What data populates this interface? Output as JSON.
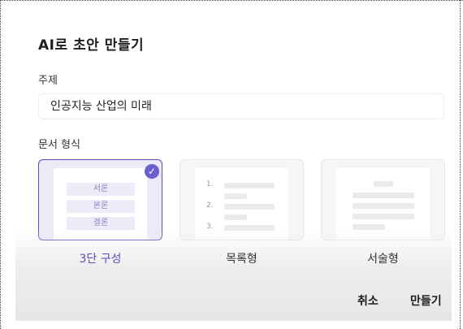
{
  "dialog": {
    "title": "AI로 초안 만들기",
    "topic_label": "주제",
    "topic_value": "인공지능 산업의 미래",
    "format_label": "문서 형식",
    "formats": [
      {
        "label": "3단 구성",
        "selected": true,
        "preview_items": [
          "서론",
          "본론",
          "결론"
        ]
      },
      {
        "label": "목록형",
        "selected": false,
        "preview_numbers": [
          "1.",
          "2.",
          "3."
        ]
      },
      {
        "label": "서술형",
        "selected": false
      }
    ],
    "cancel_label": "취소",
    "create_label": "만들기"
  },
  "colors": {
    "accent": "#5b4fbf",
    "check_badge": "#6b5fd0",
    "selected_card_bg": "#eceaf6"
  },
  "icons": {
    "selected_check": "checkmark-icon"
  }
}
